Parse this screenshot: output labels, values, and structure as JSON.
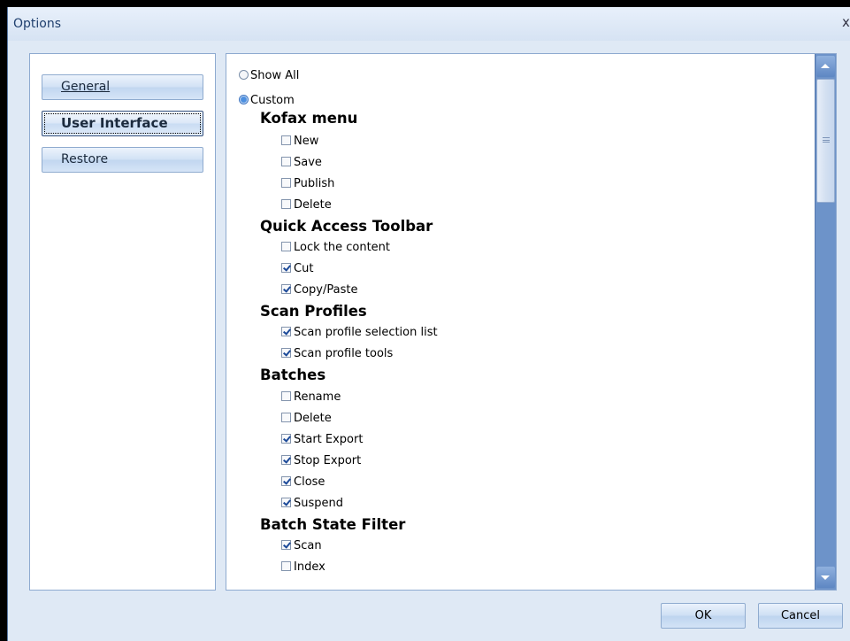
{
  "window": {
    "title": "Options",
    "close_label": "x"
  },
  "nav": [
    {
      "label": "General",
      "active": false
    },
    {
      "label": "User Interface",
      "active": true
    },
    {
      "label": "Restore",
      "active": false
    }
  ],
  "view_mode": {
    "show_all_label": "Show All",
    "custom_label": "Custom",
    "selected": "Custom"
  },
  "sections": [
    {
      "title": "Kofax menu",
      "items": [
        {
          "label": "New",
          "checked": false
        },
        {
          "label": "Save",
          "checked": false
        },
        {
          "label": "Publish",
          "checked": false
        },
        {
          "label": "Delete",
          "checked": false
        }
      ]
    },
    {
      "title": "Quick Access Toolbar",
      "items": [
        {
          "label": "Lock the content",
          "checked": false
        },
        {
          "label": "Cut",
          "checked": true
        },
        {
          "label": "Copy/Paste",
          "checked": true
        }
      ]
    },
    {
      "title": "Scan Profiles",
      "items": [
        {
          "label": "Scan profile selection list",
          "checked": true
        },
        {
          "label": "Scan profile tools",
          "checked": true
        }
      ]
    },
    {
      "title": "Batches",
      "items": [
        {
          "label": "Rename",
          "checked": false
        },
        {
          "label": "Delete",
          "checked": false
        },
        {
          "label": "Start Export",
          "checked": true
        },
        {
          "label": "Stop Export",
          "checked": true
        },
        {
          "label": "Close",
          "checked": true
        },
        {
          "label": "Suspend",
          "checked": true
        }
      ]
    },
    {
      "title": "Batch State Filter",
      "items": [
        {
          "label": "Scan",
          "checked": true
        },
        {
          "label": "Index",
          "checked": false
        }
      ]
    }
  ],
  "buttons": {
    "ok": "OK",
    "cancel": "Cancel"
  },
  "colors": {
    "scrollbar_track": "#6d93c9",
    "window_bg": "#dfe9f5",
    "title_text": "#1f3f6e"
  }
}
